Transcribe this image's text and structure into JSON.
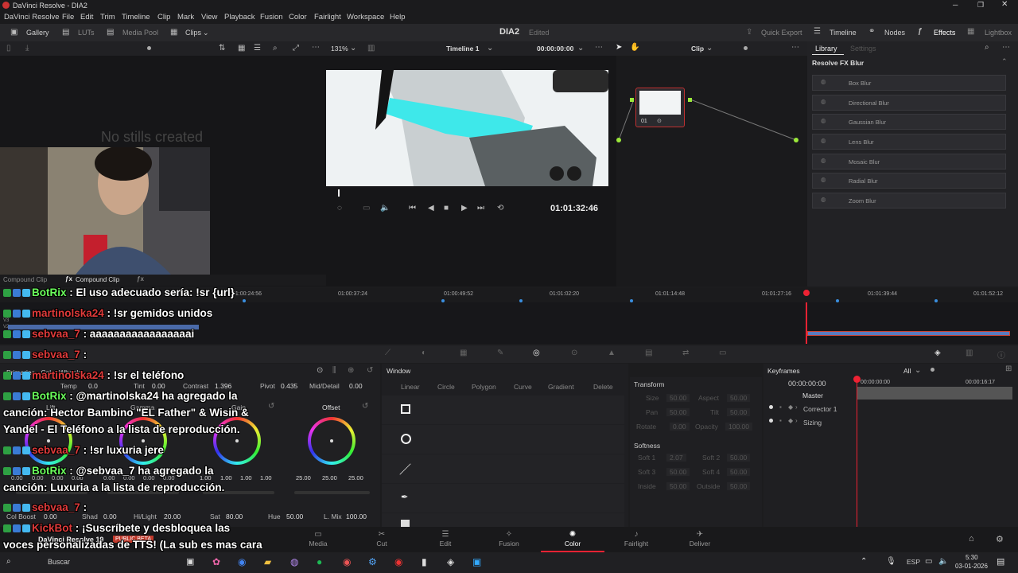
{
  "window": {
    "title": "DaVinci Resolve - DIA2"
  },
  "menu": [
    "DaVinci Resolve",
    "File",
    "Edit",
    "Trim",
    "Timeline",
    "Clip",
    "Mark",
    "View",
    "Playback",
    "Fusion",
    "Color",
    "Fairlight",
    "Workspace",
    "Help"
  ],
  "toolbar": {
    "gallery": "Gallery",
    "luts": "LUTs",
    "media_pool": "Media Pool",
    "clips": "Clips",
    "project": "DIA2",
    "status": "Edited",
    "quick_export": "Quick Export",
    "timeline": "Timeline",
    "nodes": "Nodes",
    "effects": "Effects",
    "lightbox": "Lightbox"
  },
  "viewer": {
    "zoom": "131%",
    "timeline_name": "Timeline 1",
    "timecode": "00:00:00:00",
    "clip_mode": "Clip",
    "playhead_tc": "01:01:32:46"
  },
  "gallery": {
    "empty_text": "No stills created"
  },
  "library": {
    "tab_library": "Library",
    "tab_settings": "Settings",
    "section": "Resolve FX Blur",
    "items": [
      "Box Blur",
      "Directional Blur",
      "Gaussian Blur",
      "Lens Blur",
      "Mosaic Blur",
      "Radial Blur",
      "Zoom Blur"
    ]
  },
  "node": {
    "label": "01"
  },
  "clips_bar": {
    "clip1": "Compound Clip",
    "clip2": "Compound Clip"
  },
  "timeline_ruler": [
    "01:00:24:56",
    "01:00:37:24",
    "01:00:49:52",
    "01:01:02:20",
    "01:01:14:48",
    "01:01:27:16",
    "01:01:39:44",
    "01:01:52:12"
  ],
  "track_labels": [
    "V3",
    "V2"
  ],
  "primaries": {
    "title": "Primaries - Color Wheels",
    "temp_label": "Temp",
    "temp": "0.0",
    "tint_label": "Tint",
    "tint": "0.00",
    "contrast_label": "Contrast",
    "contrast": "1.396",
    "pivot_label": "Pivot",
    "pivot": "0.435",
    "middetail_label": "Mid/Detail",
    "middetail": "0.00",
    "wheels": [
      "Lift",
      "Gamma",
      "Gain",
      "Offset"
    ],
    "lift_vals": [
      "0.00",
      "0.00",
      "0.00",
      "0.00"
    ],
    "gamma_vals": [
      "0.00",
      "0.00",
      "0.00",
      "0.00"
    ],
    "gain_vals": [
      "1.00",
      "1.00",
      "1.00",
      "1.00"
    ],
    "offset_vals": [
      "25.00",
      "25.00",
      "25.00"
    ],
    "colboost_label": "Col Boost",
    "colboost": "0.00",
    "shad_label": "Shad",
    "shad": "0.00",
    "hilight_label": "Hi/Light",
    "hilight": "20.00",
    "sat_label": "Sat",
    "sat": "80.00",
    "hue_label": "Hue",
    "hue": "50.00",
    "lmix_label": "L. Mix",
    "lmix": "100.00"
  },
  "window_panel": {
    "title": "Window",
    "linear": "Linear",
    "circle": "Circle",
    "polygon": "Polygon",
    "curve": "Curve",
    "gradient": "Gradient",
    "delete": "Delete"
  },
  "transform": {
    "title": "Transform",
    "size": "Size",
    "size_v": "50.00",
    "aspect": "Aspect",
    "aspect_v": "50.00",
    "pan": "Pan",
    "pan_v": "50.00",
    "tilt": "Tilt",
    "tilt_v": "50.00",
    "rotate": "Rotate",
    "rotate_v": "0.00",
    "opacity": "Opacity",
    "opacity_v": "100.00",
    "softness": "Softness",
    "soft1": "Soft 1",
    "soft1_v": "2.07",
    "soft2": "Soft 2",
    "soft2_v": "50.00",
    "soft3": "Soft 3",
    "soft3_v": "50.00",
    "soft4": "Soft 4",
    "soft4_v": "50.00",
    "inside": "Inside",
    "inside_v": "50.00",
    "outside": "Outside",
    "outside_v": "50.00"
  },
  "keyframes": {
    "title": "Keyframes",
    "filter": "All",
    "tc": "00:00:00:00",
    "tc2": "00:00:16:17",
    "master": "Master",
    "corrector": "Corrector 1",
    "sizing": "Sizing"
  },
  "pages": [
    "Media",
    "Cut",
    "Edit",
    "Fusion",
    "Color",
    "Fairlight",
    "Deliver"
  ],
  "footer": {
    "app": "DaVinci Resolve 19",
    "badge": "PUBLIC BETA",
    "search": "Buscar",
    "time": "5:30",
    "date": "03-01-2026",
    "lang": "ESP"
  },
  "chat": [
    {
      "user": "BotRix",
      "color": "green",
      "text": ": El uso adecuado sería: !sr {url}"
    },
    {
      "user": "martinolska24",
      "color": "red",
      "text": ": !sr gemidos unidos"
    },
    {
      "user": "sebvaa_7",
      "color": "red",
      "text": ": aaaaaaaaaaaaaaaaai"
    },
    {
      "user": "sebvaa_7",
      "color": "red",
      "text": ":"
    },
    {
      "user": "martinolska24",
      "color": "red",
      "text": ": !sr el teléfono"
    },
    {
      "user": "BotRix",
      "color": "green",
      "text": ": @martinolska24 ha agregado la"
    },
    {
      "user": "",
      "color": "",
      "text": "canción: Hector Bambino \"EL Father\" & Wisin &"
    },
    {
      "user": "",
      "color": "",
      "text": "Yandel - El Teléfono a la lista de reproducción."
    },
    {
      "user": "sebvaa_7",
      "color": "red",
      "text": ": !sr luxuria jere"
    },
    {
      "user": "BotRix",
      "color": "green",
      "text": ": @sebvaa_7 ha agregado la"
    },
    {
      "user": "",
      "color": "",
      "text": "canción: Luxuria a la lista de reproducción."
    },
    {
      "user": "sebvaa_7",
      "color": "red",
      "text": ":"
    },
    {
      "user": "KickBot",
      "color": "red",
      "text": ": ¡Suscríbete y desbloquea las"
    },
    {
      "user": "",
      "color": "",
      "text": "voces personalizadas de TTS! (La sub es mas cara"
    }
  ]
}
